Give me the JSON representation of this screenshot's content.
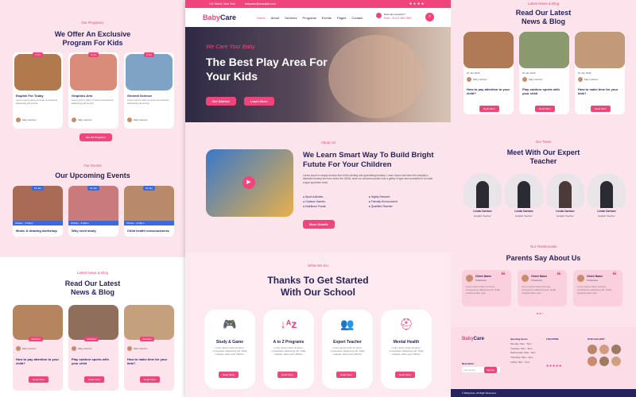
{
  "left": {
    "programs": {
      "kicker": "Our Programs",
      "title": "We Offer An Exclusive Program For Kids",
      "items": [
        {
          "age": "4 Yrs",
          "title": "English For Today"
        },
        {
          "age": "4 Yrs",
          "title": "Graphics Arts"
        },
        {
          "age": "4 Yrs",
          "title": "General Science"
        }
      ],
      "text": "Lorem ipsum dolor sit amet consectetur adipiscing elit sed do",
      "author": "Mary Herbert",
      "role": "Coordinator",
      "button": "See All Programs"
    },
    "events": {
      "kicker": "Our Events",
      "title": "Our Upcoming Events",
      "items": [
        {
          "date": "18 Jan",
          "title": "Music & drawing workshop"
        },
        {
          "date": "18 Jan",
          "title": "Why need study"
        },
        {
          "date": "18 Jan",
          "title": "Child health consciousness"
        }
      ],
      "meta": "8:00am - 5:00pm"
    },
    "news": {
      "kicker": "Latest News & Blog",
      "title": "Read Our Latest News & Blog",
      "items": [
        {
          "tag": "Activities",
          "title": "How to pay attention to your child?"
        },
        {
          "tag": "Activities",
          "title": "Play outdoor sports with your child"
        },
        {
          "tag": "Activities",
          "title": "How to make time for your kids?"
        }
      ],
      "author": "Mary Herbert",
      "role": "Coordinator",
      "button": "Read More"
    }
  },
  "center": {
    "topbar": {
      "address": "141 Street, New York",
      "email": "babycare@example.com"
    },
    "logo": {
      "baby": "Baby",
      "care": "Care"
    },
    "nav": [
      "Home",
      "About",
      "Services",
      "Programs",
      "Events",
      "Pages",
      "Contact"
    ],
    "phone": {
      "label": "Have any question?",
      "number": "Free: +0123 456 7890"
    },
    "hero": {
      "kicker": "We Care Your Baby",
      "title": "The Best Play Area For Your Kids",
      "btn1": "Get Started",
      "btn2": "Learn More"
    },
    "about": {
      "kicker": "About Us",
      "title": "We Learn Smart Way To Build Bright Futute For Your Children",
      "text": "Lorem ipsum is simply dummy text of the printing and typesetting industry. Lorem Ipsum has been the industry's standard dummy text ever since the 1500s, when an unknown printer took a galley of type and scrambled it to make a type specimen book.",
      "features": [
        "Sport Activites",
        "Highly Secured",
        "Outdoor Games",
        "Friendly Environment",
        "Nutritious Foods",
        "Qualified Teacher"
      ],
      "button": "More Details"
    },
    "services": {
      "kicker": "What We Do",
      "title": "Thanks To Get Started With Our School",
      "items": [
        {
          "title": "Study & Game"
        },
        {
          "title": "A to Z Programs"
        },
        {
          "title": "Expert Teacher"
        },
        {
          "title": "Mental Health"
        }
      ],
      "text": "Lorem ipsum dolor sit amet, consectetur adipiscing elit. Nulla volutpat, tellus quis efficitur.",
      "button": "Read More"
    }
  },
  "right": {
    "news": {
      "kicker": "Latest News & Blog",
      "title": "Read Our Latest News & Blog",
      "items": [
        {
          "title": "How to pay attention to your child?"
        },
        {
          "title": "Play outdoor sports with your child"
        },
        {
          "title": "How to make time for your kids?"
        }
      ],
      "date": "01 Jan 2045",
      "author": "Mary Herbert",
      "role": "Coordinator",
      "button": "Read More"
    },
    "team": {
      "kicker": "Our Team",
      "title": "Meet With Our Expert Teacher",
      "members": [
        {
          "name": "Linda Carlson",
          "role": "English Teacher"
        },
        {
          "name": "Linda Carlson",
          "role": "English Teacher"
        },
        {
          "name": "Linda Carlson",
          "role": "English Teacher"
        },
        {
          "name": "Linda Carlson",
          "role": "English Teacher"
        }
      ]
    },
    "testimonials": {
      "kicker": "Our Testimonials",
      "title": "Parents Say About Us",
      "name": "Client Name",
      "role": "Profession",
      "text": "Lorem ipsum dolor sit amet, consectetur adipiscing elit. Nulla volutpat tellus quis."
    },
    "footer": {
      "logo_baby": "Baby",
      "logo_care": "Care",
      "newsletter": "Newsletter",
      "email_placeholder": "Your Email",
      "signup": "SignUp",
      "hours_title": "Opening Hours",
      "hours": [
        "Monday: 8am - 5pm",
        "Tuesday: 8am - 5pm",
        "Wednesday: 8am - 5pm",
        "Thursday: 8am - 5pm",
        "Friday: 8am - 5pm"
      ],
      "location_title": "LOCATION",
      "gallery_title": "OUR GALLERY",
      "copyright": "© BabyCare, All Right Reserved."
    }
  },
  "colors": {
    "accent": "#f0457b",
    "navy": "#26235c",
    "blue": "#3c6bd9"
  }
}
